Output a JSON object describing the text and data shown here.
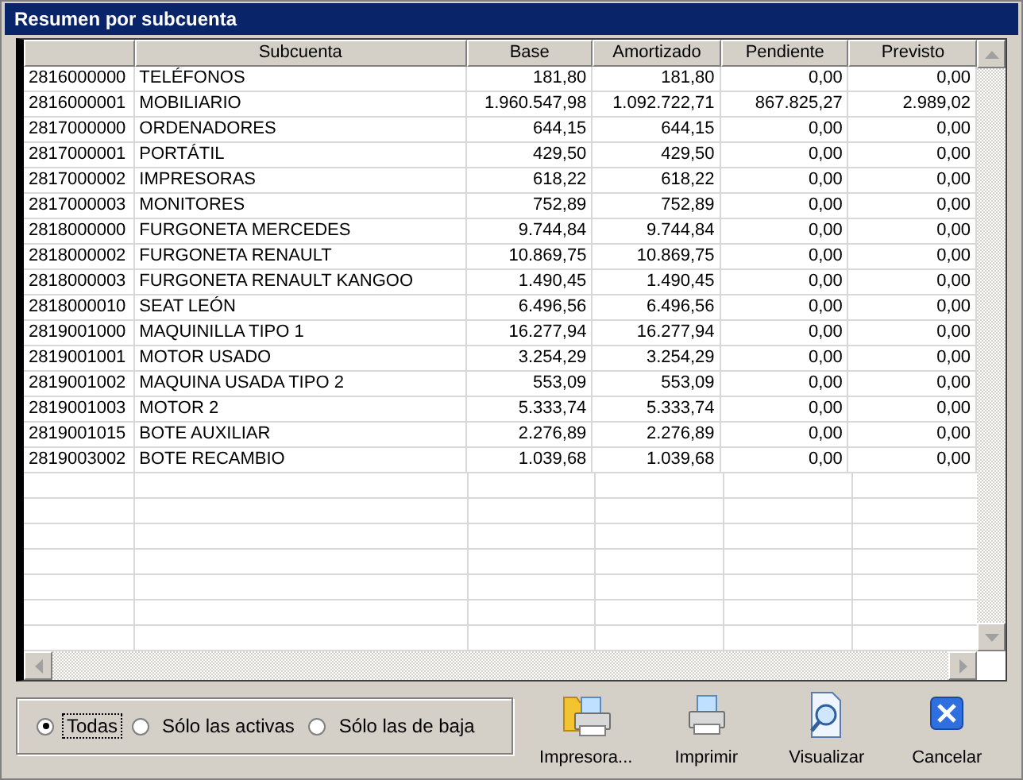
{
  "window": {
    "title": "Resumen por subcuenta"
  },
  "table": {
    "columns": [
      {
        "label": "Subcuenta"
      },
      {
        "label": "Base"
      },
      {
        "label": "Amortizado"
      },
      {
        "label": "Pendiente"
      },
      {
        "label": "Previsto"
      }
    ],
    "rows": [
      {
        "code": "2816000000",
        "name": "TELÉFONOS",
        "base": "181,80",
        "amortizado": "181,80",
        "pendiente": "0,00",
        "previsto": "0,00"
      },
      {
        "code": "2816000001",
        "name": "MOBILIARIO",
        "base": "1.960.547,98",
        "amortizado": "1.092.722,71",
        "pendiente": "867.825,27",
        "previsto": "2.989,02"
      },
      {
        "code": "2817000000",
        "name": "ORDENADORES",
        "base": "644,15",
        "amortizado": "644,15",
        "pendiente": "0,00",
        "previsto": "0,00"
      },
      {
        "code": "2817000001",
        "name": "PORTÁTIL",
        "base": "429,50",
        "amortizado": "429,50",
        "pendiente": "0,00",
        "previsto": "0,00"
      },
      {
        "code": "2817000002",
        "name": "IMPRESORAS",
        "base": "618,22",
        "amortizado": "618,22",
        "pendiente": "0,00",
        "previsto": "0,00"
      },
      {
        "code": "2817000003",
        "name": "MONITORES",
        "base": "752,89",
        "amortizado": "752,89",
        "pendiente": "0,00",
        "previsto": "0,00"
      },
      {
        "code": "2818000000",
        "name": "FURGONETA MERCEDES",
        "base": "9.744,84",
        "amortizado": "9.744,84",
        "pendiente": "0,00",
        "previsto": "0,00"
      },
      {
        "code": "2818000002",
        "name": "FURGONETA RENAULT",
        "base": "10.869,75",
        "amortizado": "10.869,75",
        "pendiente": "0,00",
        "previsto": "0,00"
      },
      {
        "code": "2818000003",
        "name": "FURGONETA RENAULT KANGOO",
        "base": "1.490,45",
        "amortizado": "1.490,45",
        "pendiente": "0,00",
        "previsto": "0,00"
      },
      {
        "code": "2818000010",
        "name": "SEAT LEÓN",
        "base": "6.496,56",
        "amortizado": "6.496,56",
        "pendiente": "0,00",
        "previsto": "0,00"
      },
      {
        "code": "2819001000",
        "name": "MAQUINILLA TIPO 1",
        "base": "16.277,94",
        "amortizado": "16.277,94",
        "pendiente": "0,00",
        "previsto": "0,00"
      },
      {
        "code": "2819001001",
        "name": "MOTOR USADO",
        "base": "3.254,29",
        "amortizado": "3.254,29",
        "pendiente": "0,00",
        "previsto": "0,00"
      },
      {
        "code": "2819001002",
        "name": "MAQUINA USADA TIPO 2",
        "base": "553,09",
        "amortizado": "553,09",
        "pendiente": "0,00",
        "previsto": "0,00"
      },
      {
        "code": "2819001003",
        "name": "MOTOR 2",
        "base": "5.333,74",
        "amortizado": "5.333,74",
        "pendiente": "0,00",
        "previsto": "0,00"
      },
      {
        "code": "2819001015",
        "name": "BOTE AUXILIAR",
        "base": "2.276,89",
        "amortizado": "2.276,89",
        "pendiente": "0,00",
        "previsto": "0,00"
      },
      {
        "code": "2819003002",
        "name": "BOTE RECAMBIO",
        "base": "1.039,68",
        "amortizado": "1.039,68",
        "pendiente": "0,00",
        "previsto": "0,00"
      }
    ]
  },
  "filter": {
    "options": [
      {
        "label": "Todas",
        "selected": true
      },
      {
        "label": "Sólo las activas",
        "selected": false
      },
      {
        "label": "Sólo las de baja",
        "selected": false
      }
    ]
  },
  "buttons": [
    {
      "label": "Impresora...",
      "kind": "printer-setup"
    },
    {
      "label": "Imprimir",
      "kind": "print"
    },
    {
      "label": "Visualizar",
      "kind": "preview"
    },
    {
      "label": "Cancelar",
      "kind": "cancel"
    }
  ]
}
